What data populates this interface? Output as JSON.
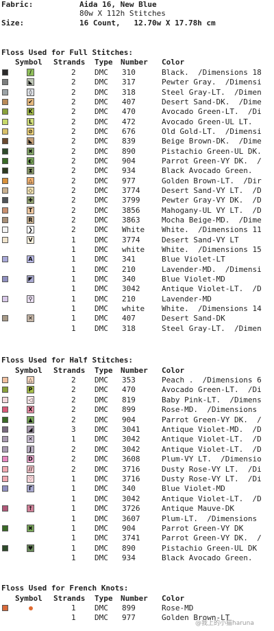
{
  "header": {
    "fabric_label": "Fabric:",
    "fabric_value": "Aida 16, New Blue",
    "stitches_value": "80w X 112h Stitches",
    "size_label": "Size:",
    "size_value": "16 Count,   12.70w X 17.78h cm"
  },
  "columns": {
    "symbol": "Symbol",
    "strands": "Strands",
    "type": "Type",
    "number": "Number",
    "color": "Color"
  },
  "full": {
    "title": "Floss Used for Full Stitches:",
    "rows": [
      {
        "chip": "#2a2a2a",
        "fill": "#8fbf5a",
        "glyph": "/",
        "strands": "2",
        "type": "DMC",
        "number": "310",
        "name": "Black.  /Dimensions 18"
      },
      {
        "chip": "#7c7e7e",
        "fill": "#bfc7b6",
        "glyph": "◣",
        "strands": "2",
        "type": "DMC",
        "number": "317",
        "name": "Pewter Gray.  /Dimensi"
      },
      {
        "chip": "#9aa2a6",
        "fill": "#dcdfe4",
        "glyph": "◊",
        "strands": "2",
        "type": "DMC",
        "number": "318",
        "name": "Steel Gray-LT.  /Dimen"
      },
      {
        "chip": "#b88a58",
        "fill": "#e5b87e",
        "glyph": "✔",
        "strands": "2",
        "type": "DMC",
        "number": "407",
        "name": "Desert Sand-DK.  /Dime"
      },
      {
        "chip": "#8aa23c",
        "fill": "#a8c04a",
        "glyph": "K",
        "strands": "2",
        "type": "DMC",
        "number": "470",
        "name": "Avocado Green-LT.  /Di"
      },
      {
        "chip": "#c6d86a",
        "fill": "#d2e07a",
        "glyph": "L",
        "strands": "2",
        "type": "DMC",
        "number": "472",
        "name": "Avocado Green-UL LT.  "
      },
      {
        "chip": "#d8c06a",
        "fill": "#f0d47a",
        "glyph": "⊘",
        "strands": "2",
        "type": "DMC",
        "number": "676",
        "name": "Old Gold-LT.  /Dimensi"
      },
      {
        "chip": "#6a4a30",
        "fill": "#c4a078",
        "glyph": "◣",
        "strands": "2",
        "type": "DMC",
        "number": "839",
        "name": "Beige Brown-DK.  /Dime"
      },
      {
        "chip": "#2e4a2a",
        "fill": "#86a86a",
        "glyph": "✖",
        "strands": "2",
        "type": "DMC",
        "number": "890",
        "name": "Pistachio Green-UL DK."
      },
      {
        "chip": "#3a6a26",
        "fill": "#7aa85a",
        "glyph": "◐",
        "strands": "2",
        "type": "DMC",
        "number": "904",
        "name": "Parrot Green-VY DK.  /"
      },
      {
        "chip": "#2e3a20",
        "fill": "#8a9a6a",
        "glyph": "⧗",
        "strands": "2",
        "type": "DMC",
        "number": "934",
        "name": "Black Avocado Green.  "
      },
      {
        "chip": "#d8903a",
        "fill": "#f0b070",
        "glyph": "△",
        "strands": "2",
        "type": "DMC",
        "number": "977",
        "name": "Golden Brown-LT.  /Dir"
      },
      {
        "chip": "#c8b090",
        "fill": "#f0e0b0",
        "glyph": "◇",
        "strands": "2",
        "type": "DMC",
        "number": "3774",
        "name": "Desert Sand-VY LT.  /D"
      },
      {
        "chip": "#505458",
        "fill": "#90a070",
        "glyph": "✚",
        "strands": "2",
        "type": "DMC",
        "number": "3799",
        "name": "Pewter Gray-VY DK.  /D"
      },
      {
        "chip": "#c89070",
        "fill": "#f0c8a0",
        "glyph": "T",
        "strands": "2",
        "type": "DMC",
        "number": "3856",
        "name": "Mahogany-UL VY LT.  /D"
      },
      {
        "chip": "#a89078",
        "fill": "#c8b090",
        "glyph": "R",
        "strands": "2",
        "type": "DMC",
        "number": "3863",
        "name": "Mocha Beige-MD.  /Dime"
      },
      {
        "chip": "#f4f4f4",
        "fill": "#ffffff",
        "glyph": "❯",
        "strands": "2",
        "type": "DMC",
        "number": "White",
        "name": "White.  /Dimensions 11"
      },
      {
        "chip": "#f0e4cc",
        "fill": "#fff6e0",
        "glyph": "V",
        "strands": "1",
        "type": "DMC",
        "number": "3774",
        "name": "Desert Sand-VY LT"
      },
      {
        "chip": "",
        "fill": "",
        "glyph": "",
        "strands": "1",
        "type": "DMC",
        "number": "white",
        "name": "White.  /Dimensions 15"
      },
      {
        "chip": "#a8a8d8",
        "fill": "#b8b8e8",
        "glyph": "A",
        "strands": "1",
        "type": "DMC",
        "number": "341",
        "name": "Blue Violet-LT"
      },
      {
        "chip": "",
        "fill": "",
        "glyph": "",
        "strands": "1",
        "type": "DMC",
        "number": "210",
        "name": "Lavender-MD.  /Dimensi"
      },
      {
        "chip": "#9090c0",
        "fill": "#a8a8d0",
        "glyph": "◤",
        "strands": "1",
        "type": "DMC",
        "number": "340",
        "name": "Blue Violet-MD"
      },
      {
        "chip": "",
        "fill": "",
        "glyph": "",
        "strands": "1",
        "type": "DMC",
        "number": "3042",
        "name": "Antique Violet-LT.  /D"
      },
      {
        "chip": "#d8c8e8",
        "fill": "#ece0f4",
        "glyph": "⚲",
        "strands": "1",
        "type": "DMC",
        "number": "210",
        "name": "Lavender-MD"
      },
      {
        "chip": "",
        "fill": "",
        "glyph": "",
        "strands": "1",
        "type": "DMC",
        "number": "white",
        "name": "White.  /Dimensions 14"
      },
      {
        "chip": "#a89a88",
        "fill": "#c8b8a8",
        "glyph": "✕",
        "strands": "1",
        "type": "DMC",
        "number": "407",
        "name": "Desert Sand-DK"
      },
      {
        "chip": "",
        "fill": "",
        "glyph": "",
        "strands": "1",
        "type": "DMC",
        "number": "318",
        "name": "Steel Gray-LT.  /Dimen"
      }
    ]
  },
  "half": {
    "title": "Floss Used for Half Stitches:",
    "rows": [
      {
        "chip": "#f0c0a0",
        "fill": "#f8d8c0",
        "glyph": "△",
        "strands": "2",
        "type": "DMC",
        "number": "353",
        "name": "Peach .  /Dimensions 6"
      },
      {
        "chip": "#8aa23c",
        "fill": "#a8c04a",
        "glyph": "P",
        "strands": "2",
        "type": "DMC",
        "number": "470",
        "name": "Avocado Green-LT.  /Di"
      },
      {
        "chip": "#f4d8dc",
        "fill": "#fae8ea",
        "glyph": "◁",
        "strands": "2",
        "type": "DMC",
        "number": "819",
        "name": "Baby Pink-LT.  /Dimens"
      },
      {
        "chip": "#d85a78",
        "fill": "#f090a8",
        "glyph": "X",
        "strands": "2",
        "type": "DMC",
        "number": "899",
        "name": "Rose-MD.  /Dimensions "
      },
      {
        "chip": "#3a6a26",
        "fill": "#7aa85a",
        "glyph": "▲",
        "strands": "2",
        "type": "DMC",
        "number": "904",
        "name": "Parrot Green-VY DK.  /"
      },
      {
        "chip": "#786a7e",
        "fill": "#a89aae",
        "glyph": "◢",
        "strands": "3",
        "type": "DMC",
        "number": "3041",
        "name": "Antique Violet-MD.  /D"
      },
      {
        "chip": "#a89ab0",
        "fill": "#cabed2",
        "glyph": "✕",
        "strands": "1",
        "type": "DMC",
        "number": "3042",
        "name": "Antique Violet-LT.  /D"
      },
      {
        "chip": "#a89ab0",
        "fill": "#bcb0c4",
        "glyph": "J",
        "strands": "2",
        "type": "DMC",
        "number": "3042",
        "name": "Antique Violet-LT.  /D"
      },
      {
        "chip": "#e888c0",
        "fill": "#f0a8d0",
        "glyph": "D",
        "strands": "2",
        "type": "DMC",
        "number": "3608",
        "name": "Plum-VY LT.  /Dimensio"
      },
      {
        "chip": "#f0a8b0",
        "fill": "#f8c4ca",
        "glyph": "//",
        "strands": "2",
        "type": "DMC",
        "number": "3716",
        "name": "Dusty Rose-VY LT.  /Di"
      },
      {
        "chip": "#f0a8b0",
        "fill": "#fcd8dc",
        "glyph": "♡",
        "strands": "1",
        "type": "DMC",
        "number": "3716",
        "name": "Dusty Rose-VY LT.  /Di"
      },
      {
        "chip": "#9090c0",
        "fill": "#a8a8d0",
        "glyph": "Γ",
        "strands": "1",
        "type": "DMC",
        "number": "340",
        "name": "Blue Violet-MD"
      },
      {
        "chip": "",
        "fill": "",
        "glyph": "",
        "strands": "1",
        "type": "DMC",
        "number": "3042",
        "name": "Antique Violet-LT.  /D"
      },
      {
        "chip": "#b05878",
        "fill": "#d08098",
        "glyph": "↑",
        "strands": "1",
        "type": "DMC",
        "number": "3726",
        "name": "Antique Mauve-DK"
      },
      {
        "chip": "",
        "fill": "",
        "glyph": "",
        "strands": "1",
        "type": "DMC",
        "number": "3607",
        "name": "Plum-LT.  /Dimensions "
      },
      {
        "chip": "#3a6a26",
        "fill": "#7aa85a",
        "glyph": "✖",
        "strands": "1",
        "type": "DMC",
        "number": "904",
        "name": "Parrot Green-VY DK"
      },
      {
        "chip": "",
        "fill": "",
        "glyph": "",
        "strands": "1",
        "type": "DMC",
        "number": "3741",
        "name": "Parrot Green-VY DK.  /"
      },
      {
        "chip": "#2e4a2a",
        "fill": "#6a8a5a",
        "glyph": "♥",
        "strands": "1",
        "type": "DMC",
        "number": "890",
        "name": "Pistachio Green-UL DK"
      },
      {
        "chip": "",
        "fill": "",
        "glyph": "",
        "strands": "1",
        "type": "DMC",
        "number": "934",
        "name": "Black Avocado Green.  "
      }
    ]
  },
  "knots": {
    "title": "Floss Used for French Knots:",
    "rows": [
      {
        "chip": "#d86a3a",
        "knot": "#e06a30",
        "strands": "1",
        "type": "DMC",
        "number": "899",
        "name": "Rose-MD"
      },
      {
        "chip": "",
        "knot": "",
        "strands": "1",
        "type": "DMC",
        "number": "977",
        "name": "Golden Brown-LT"
      }
    ]
  },
  "watermark": "@我上的小猫haruna"
}
